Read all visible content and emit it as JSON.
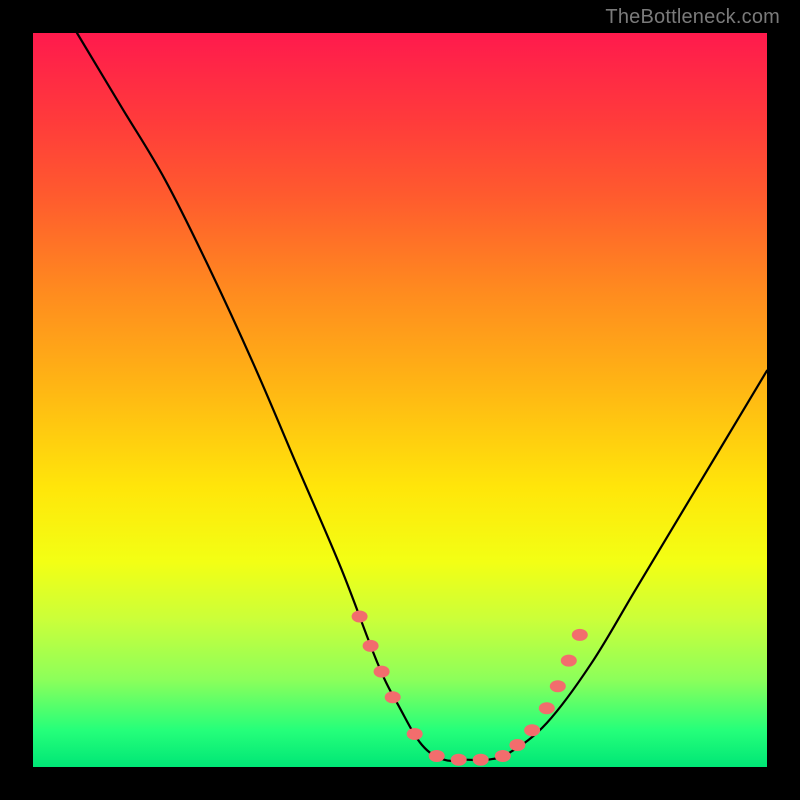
{
  "watermark": "TheBottleneck.com",
  "colors": {
    "background": "#000000",
    "curve": "#000000",
    "dots": "#f26d6d",
    "gradient_stops": [
      "#ff1a4d",
      "#ff3b3b",
      "#ff5a2e",
      "#ff8a1f",
      "#ffb514",
      "#ffe60a",
      "#f3ff14",
      "#caff3a",
      "#8dff5a",
      "#25ff7a",
      "#00e676"
    ]
  },
  "chart_data": {
    "type": "line",
    "title": "",
    "xlabel": "",
    "ylabel": "",
    "xlim": [
      0,
      100
    ],
    "ylim": [
      0,
      100
    ],
    "series": [
      {
        "name": "bottleneck-curve",
        "x": [
          6,
          12,
          18,
          24,
          30,
          36,
          42,
          47,
          50,
          53,
          56,
          59,
          62,
          65,
          70,
          76,
          82,
          88,
          94,
          100
        ],
        "y": [
          100,
          90,
          80,
          68,
          55,
          41,
          27,
          14,
          8,
          3,
          1,
          1,
          1,
          2,
          6,
          14,
          24,
          34,
          44,
          54
        ]
      }
    ],
    "markers": {
      "name": "highlighted-points",
      "x": [
        44.5,
        46.0,
        47.5,
        49.0,
        52.0,
        55.0,
        58.0,
        61.0,
        64.0,
        66.0,
        68.0,
        70.0,
        71.5,
        73.0,
        74.5
      ],
      "y": [
        20.5,
        16.5,
        13.0,
        9.5,
        4.5,
        1.5,
        1.0,
        1.0,
        1.5,
        3.0,
        5.0,
        8.0,
        11.0,
        14.5,
        18.0
      ]
    }
  }
}
